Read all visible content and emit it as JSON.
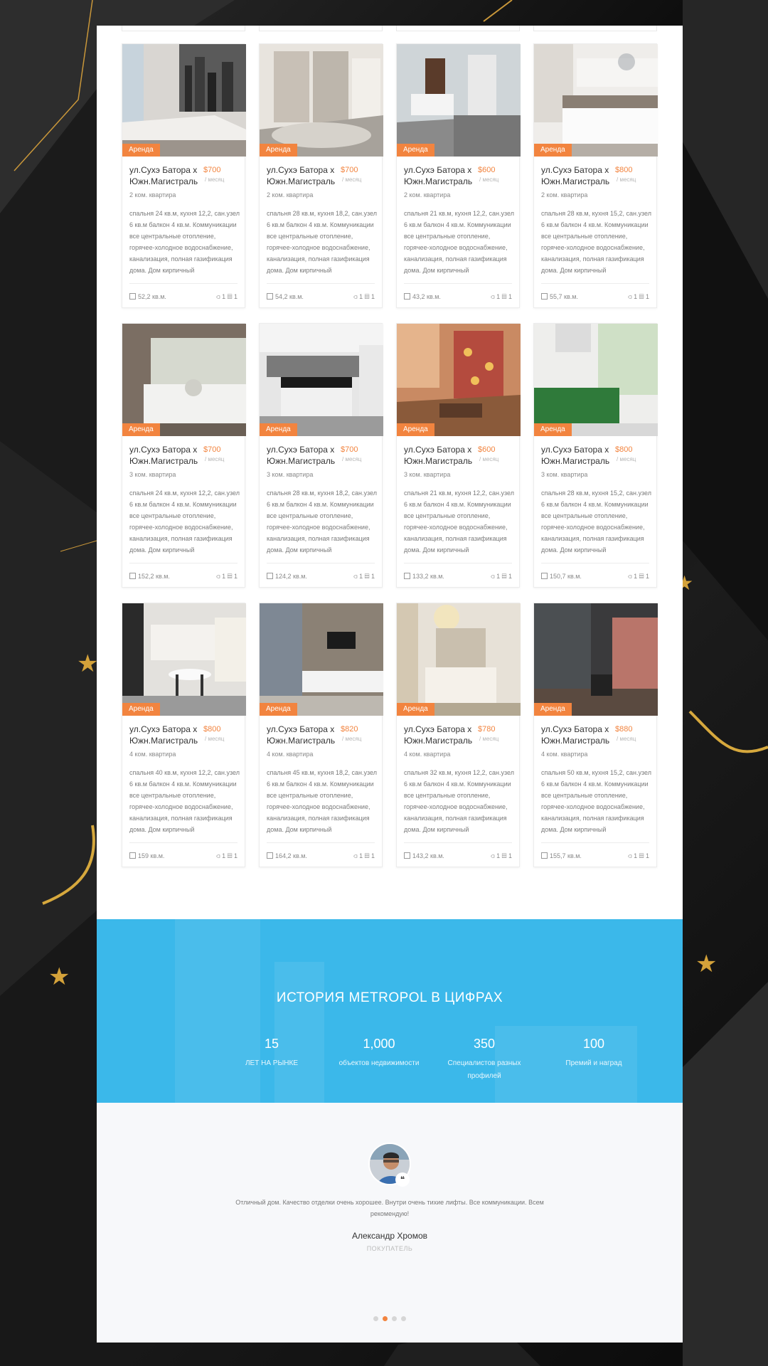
{
  "listings": [
    {
      "tag": "Аренда",
      "address": "ул.Сухэ Батора х Южн.Магистраль",
      "price": "$700",
      "per": "/ месяц",
      "rooms": "2 ком. квартира",
      "description": "спальня 24 кв.м, кухня 12,2, сан.узел 6 кв.м балкон 4 кв.м. Коммуникации все центральные отопление, горячее-холодное водоснабжение, канализация, полная газификация дома. Дом кирпичный",
      "area": "52,2 кв.м.",
      "baths": "1",
      "beds": "1",
      "photo": "bedroom-city"
    },
    {
      "tag": "Аренда",
      "address": "ул.Сухэ Батора х Южн.Магистраль",
      "price": "$700",
      "per": "/ месяц",
      "rooms": "2 ком. квартира",
      "description": "спальня 28 кв.м, кухня 18,2, сан.узел 6 кв.м балкон 4 кв.м. Коммуникации все центральные отопление, горячее-холодное водоснабжение, канализация, полная газификация дома. Дом кирпичный",
      "area": "54,2 кв.м.",
      "baths": "1",
      "beds": "1",
      "photo": "hallway-mirror"
    },
    {
      "tag": "Аренда",
      "address": "ул.Сухэ Батора х Южн.Магистраль",
      "price": "$600",
      "per": "/ месяц",
      "rooms": "2 ком. квартира",
      "description": "спальня 21 кв.м, кухня 12,2, сан.узел 6 кв.м балкон 4 кв.м. Коммуникации все центральные отопление, горячее-холодное водоснабжение, канализация, полная газификация дома. Дом кирпичный",
      "area": "43,2 кв.м.",
      "baths": "1",
      "beds": "1",
      "photo": "bedroom-white"
    },
    {
      "tag": "Аренда",
      "address": "ул.Сухэ Батора х Южн.Магистраль",
      "price": "$800",
      "per": "/ месяц",
      "rooms": "2 ком. квартира",
      "description": "спальня 28 кв.м, кухня 15,2, сан.узел 6 кв.м балкон 4 кв.м. Коммуникации все центральные отопление, горячее-холодное водоснабжение, канализация, полная газификация дома. Дом кирпичный",
      "area": "55,7 кв.м.",
      "baths": "1",
      "beds": "1",
      "photo": "bedroom-wardrobe"
    },
    {
      "tag": "Аренда",
      "address": "ул.Сухэ Батора х Южн.Магистраль",
      "price": "$700",
      "per": "/ месяц",
      "rooms": "3 ком. квартира",
      "description": "спальня 24 кв.м, кухня 12,2, сан.узел 6 кв.м балкон 4 кв.м. Коммуникации все центральные отопление, горячее-холодное водоснабжение, канализация, полная газификация дома. Дом кирпичный",
      "area": "152,2 кв.м.",
      "baths": "1",
      "beds": "1",
      "photo": "bedroom-headboard"
    },
    {
      "tag": "Аренда",
      "address": "ул.Сухэ Батора х Южн.Магистраль",
      "price": "$700",
      "per": "/ месяц",
      "rooms": "3 ком. квартира",
      "description": "спальня 28 кв.м, кухня 18,2, сан.узел 6 кв.м балкон 4 кв.м. Коммуникации все центральные отопление, горячее-холодное водоснабжение, канализация, полная газификация дома. Дом кирпичный",
      "area": "124,2 кв.м.",
      "baths": "1",
      "beds": "1",
      "photo": "kitchen-black"
    },
    {
      "tag": "Аренда",
      "address": "ул.Сухэ Батора х Южн.Магистраль",
      "price": "$600",
      "per": "/ месяц",
      "rooms": "3 ком. квартира",
      "description": "спальня 21 кв.м, кухня 12,2, сан.узел 6 кв.м балкон 4 кв.м. Коммуникации все центральные отопление, горячее-холодное водоснабжение, канализация, полная газификация дома. Дом кирпичный",
      "area": "133,2 кв.м.",
      "baths": "1",
      "beds": "1",
      "photo": "living-floral"
    },
    {
      "tag": "Аренда",
      "address": "ул.Сухэ Батора х Южн.Магистраль",
      "price": "$800",
      "per": "/ месяц",
      "rooms": "3 ком. квартира",
      "description": "спальня 28 кв.м, кухня 15,2, сан.узел 6 кв.м балкон 4 кв.м. Коммуникации все центральные отопление, горячее-холодное водоснабжение, канализация, полная газификация дома. Дом кирпичный",
      "area": "150,7 кв.м.",
      "baths": "1",
      "beds": "1",
      "photo": "kitchen-green"
    },
    {
      "tag": "Аренда",
      "address": "ул.Сухэ Батора х Южн.Магистраль",
      "price": "$800",
      "per": "/ месяц",
      "rooms": "4 ком. квартира",
      "description": "спальня 40 кв.м, кухня 12,2, сан.узел 6 кв.м балкон 4 кв.м. Коммуникации все центральные отопление, горячее-холодное водоснабжение, канализация, полная газификация дома. Дом кирпичный",
      "area": "159 кв.м.",
      "baths": "1",
      "beds": "1",
      "photo": "dining-kitchen"
    },
    {
      "tag": "Аренда",
      "address": "ул.Сухэ Батора х Южн.Магистраль",
      "price": "$820",
      "per": "/ месяц",
      "rooms": "4 ком. квартира",
      "description": "спальня 45 кв.м, кухня 18,2, сан.узел 6 кв.м балкон 4 кв.м. Коммуникации все центральные отопление, горячее-холодное водоснабжение, канализация, полная газификация дома. Дом кирпичный",
      "area": "164,2 кв.м.",
      "baths": "1",
      "beds": "1",
      "photo": "living-tv"
    },
    {
      "tag": "Аренда",
      "address": "ул.Сухэ Батора х Южн.Магистраль",
      "price": "$780",
      "per": "/ месяц",
      "rooms": "4 ком. квартира",
      "description": "спальня 32 кв.м, кухня 12,2, сан.узел 6 кв.м балкон 4 кв.м. Коммуникации все центральные отопление, горячее-холодное водоснабжение, канализация, полная газификация дома. Дом кирпичный",
      "area": "143,2 кв.м.",
      "baths": "1",
      "beds": "1",
      "photo": "bedroom-luxury"
    },
    {
      "tag": "Аренда",
      "address": "ул.Сухэ Батора х Южн.Магистраль",
      "price": "$880",
      "per": "/ месяц",
      "rooms": "4 ком. квартира",
      "description": "спальня 50 кв.м, кухня 15,2, сан.узел 6 кв.м балкон 4 кв.м. Коммуникации все центральные отопление, горячее-холодное водоснабжение, канализация, полная газификация дома. Дом кирпичный",
      "area": "155,7 кв.м.",
      "baths": "1",
      "beds": "1",
      "photo": "living-dark"
    }
  ],
  "stats": {
    "title": "ИСТОРИЯ METROPOL В ЦИФРАХ",
    "items": [
      {
        "value": "15",
        "label": "ЛЕТ НА РЫНКЕ"
      },
      {
        "value": "1,000",
        "label": "объектов недвижимости"
      },
      {
        "value": "350",
        "label": "Специалистов разных профилей"
      },
      {
        "value": "100",
        "label": "Премий и наград"
      }
    ]
  },
  "testimonial": {
    "quote_mark": "❝",
    "text": "Отличный дом. Качество отделки очень хорошее. Внутри очень тихие лифты. Все коммуникации. Всем рекомендую!",
    "name": "Александр Хромов",
    "role": "ПОКУПАТЕЛЬ",
    "active_slide": 2,
    "slide_count": 4
  },
  "colors": {
    "accent": "#f2843f",
    "stats_bg": "#3bb8ea",
    "star": "#d4a23a"
  }
}
